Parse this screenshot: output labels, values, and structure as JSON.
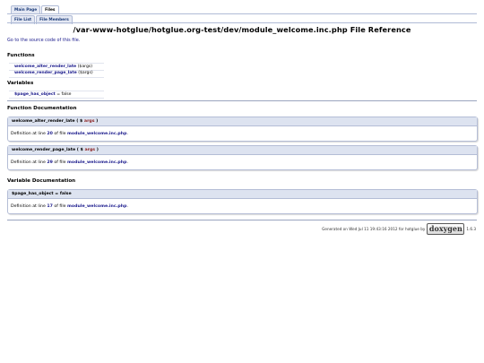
{
  "tabs_top": [
    "Main Page",
    "Files"
  ],
  "tabs_sub": [
    "File List",
    "File Members"
  ],
  "title": "/var-www-hotglue/hotglue.org-test/dev/module_welcome.inc.php File Reference",
  "source_link": "Go to the source code of this file.",
  "sections": {
    "functions": "Functions",
    "variables": "Variables",
    "function_doc": "Function Documentation",
    "variable_doc": "Variable Documentation"
  },
  "functions": [
    {
      "name": "welcome_alter_render_late",
      "args": "($args)"
    },
    {
      "name": "welcome_render_page_late",
      "args": "($args)"
    }
  ],
  "variables": [
    {
      "name": "$page_has_object",
      "value": "= false"
    }
  ],
  "function_docs": [
    {
      "proto_name": "welcome_alter_render_late",
      "proto_open": "( $",
      "proto_arg": "args",
      "proto_close": ")",
      "doc_prefix": "Definition at line",
      "line": "20",
      "doc_mid": "of file",
      "file": "module_welcome.inc.php",
      "doc_end": "."
    },
    {
      "proto_name": "welcome_render_page_late",
      "proto_open": "( $",
      "proto_arg": "args",
      "proto_close": ")",
      "doc_prefix": "Definition at line",
      "line": "29",
      "doc_mid": "of file",
      "file": "module_welcome.inc.php",
      "doc_end": "."
    }
  ],
  "variable_docs": [
    {
      "proto": "$page_has_object = false",
      "doc_prefix": "Definition at line",
      "line": "17",
      "doc_mid": "of file",
      "file": "module_welcome.inc.php",
      "doc_end": "."
    }
  ],
  "footer": {
    "text": "Generated on Wed Jul 11 19:43:16 2012 for hotglue by",
    "logo": "doxygen",
    "version": "1.6.3"
  }
}
